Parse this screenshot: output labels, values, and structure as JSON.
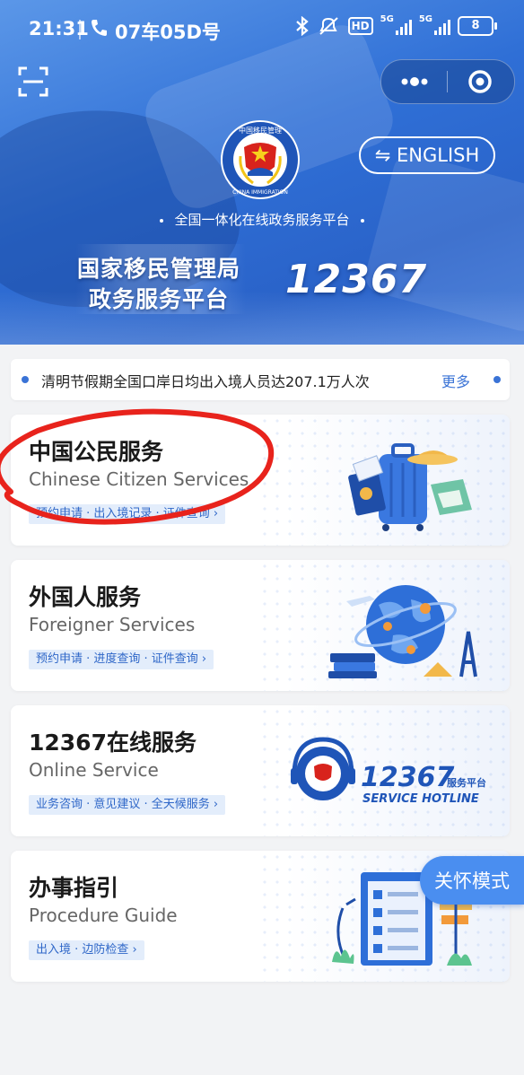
{
  "status_bar": {
    "time": "21:31",
    "app_text": "07车05D号",
    "hd_label": "HD",
    "net1": "5G",
    "net2": "5G",
    "battery": "8"
  },
  "header": {
    "english_button": "⇋ ENGLISH",
    "platform_subtitle": "全国一体化在线政务服务平台",
    "title_line1": "国家移民管理局",
    "title_line2": "政务服务平台",
    "hotline": "12367",
    "emblem_top_text": "中国移民管理",
    "emblem_bottom_text": "CHINA IMMIGRATION"
  },
  "notice": {
    "text": "清明节假期全国口岸日均出入境人员达207.1万人次",
    "more": "更多"
  },
  "cards": [
    {
      "title": "中国公民服务",
      "subtitle": "Chinese Citizen Services",
      "tags": "预约申请 · 出入境记录 · 证件查询 ›"
    },
    {
      "title": "外国人服务",
      "subtitle": "Foreigner Services",
      "tags": "预约申请 · 进度查询 · 证件查询 ›"
    },
    {
      "title": "12367在线服务",
      "subtitle": "Online Service",
      "tags": "业务咨询 · 意见建议 · 全天候服务 ›",
      "art_number": "12367",
      "art_suffix": "服务平台",
      "art_caption": "SERVICE HOTLINE"
    },
    {
      "title": "办事指引",
      "subtitle": "Procedure Guide",
      "tags": "出入境 · 边防检查 ›"
    }
  ],
  "care_mode": "关怀模式",
  "colors": {
    "brand_blue": "#2f6fd6",
    "accent_blue": "#3a73d6",
    "annotation_red": "#e8231c"
  }
}
